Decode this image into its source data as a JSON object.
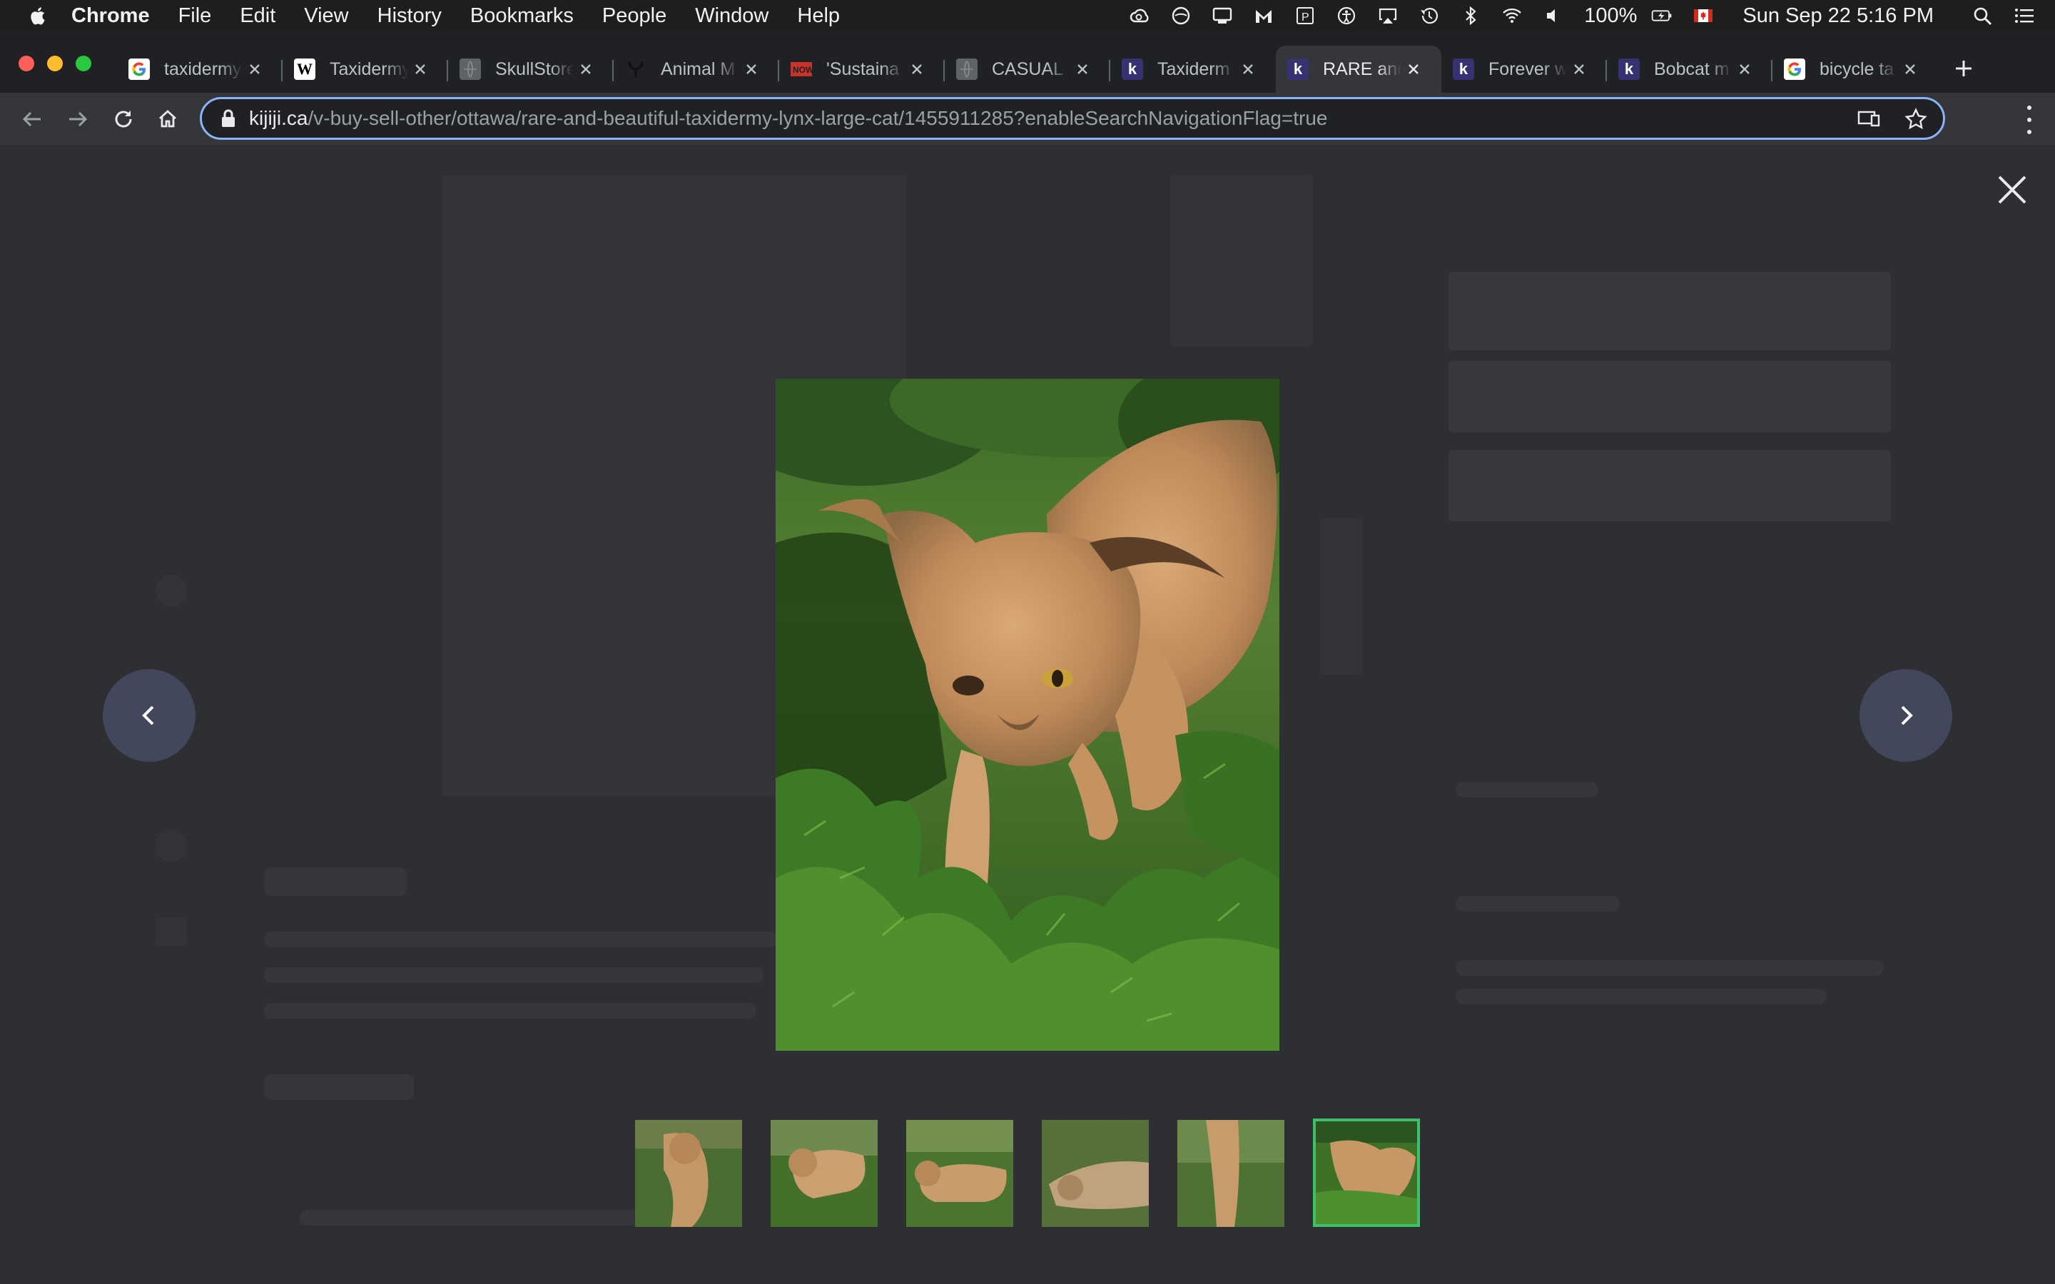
{
  "menubar": {
    "app_name": "Chrome",
    "menus": [
      "File",
      "Edit",
      "View",
      "History",
      "Bookmarks",
      "People",
      "Window",
      "Help"
    ],
    "battery": "100%",
    "datetime": "Sun Sep 22  5:16 PM"
  },
  "tabs": [
    {
      "title": "taxidermy",
      "favicon": "google-icon",
      "active": false
    },
    {
      "title": "Taxidermy",
      "favicon": "wikipedia-icon",
      "active": false
    },
    {
      "title": "SkullStore",
      "favicon": "globe-icon",
      "active": false
    },
    {
      "title": "Animal M",
      "favicon": "antler-icon",
      "active": false
    },
    {
      "title": "'Sustaina",
      "favicon": "now-icon",
      "active": false
    },
    {
      "title": "CASUAL",
      "favicon": "globe-icon",
      "active": false
    },
    {
      "title": "Taxiderm",
      "favicon": "kijiji-icon",
      "active": false
    },
    {
      "title": "RARE and",
      "favicon": "kijiji-icon",
      "active": true
    },
    {
      "title": "Forever w",
      "favicon": "kijiji-icon",
      "active": false
    },
    {
      "title": "Bobcat m",
      "favicon": "kijiji-icon",
      "active": false
    },
    {
      "title": "bicycle ta",
      "favicon": "google-icon",
      "active": false
    }
  ],
  "address_bar": {
    "host": "kijiji.ca",
    "path": "/v-buy-sell-other/ottawa/rare-and-beautiful-taxidermy-lynx-large-cat/1455911285?enableSearchNavigationFlag=true"
  },
  "gallery": {
    "thumbnail_count": 6,
    "selected_index": 6,
    "main_photo_subject": "taxidermy lynx on evergreen foliage"
  },
  "colors": {
    "accent_selected_thumb": "#3ec06a",
    "omnibox_focus": "#8ab4f8",
    "arrow_button": "#43475c"
  }
}
